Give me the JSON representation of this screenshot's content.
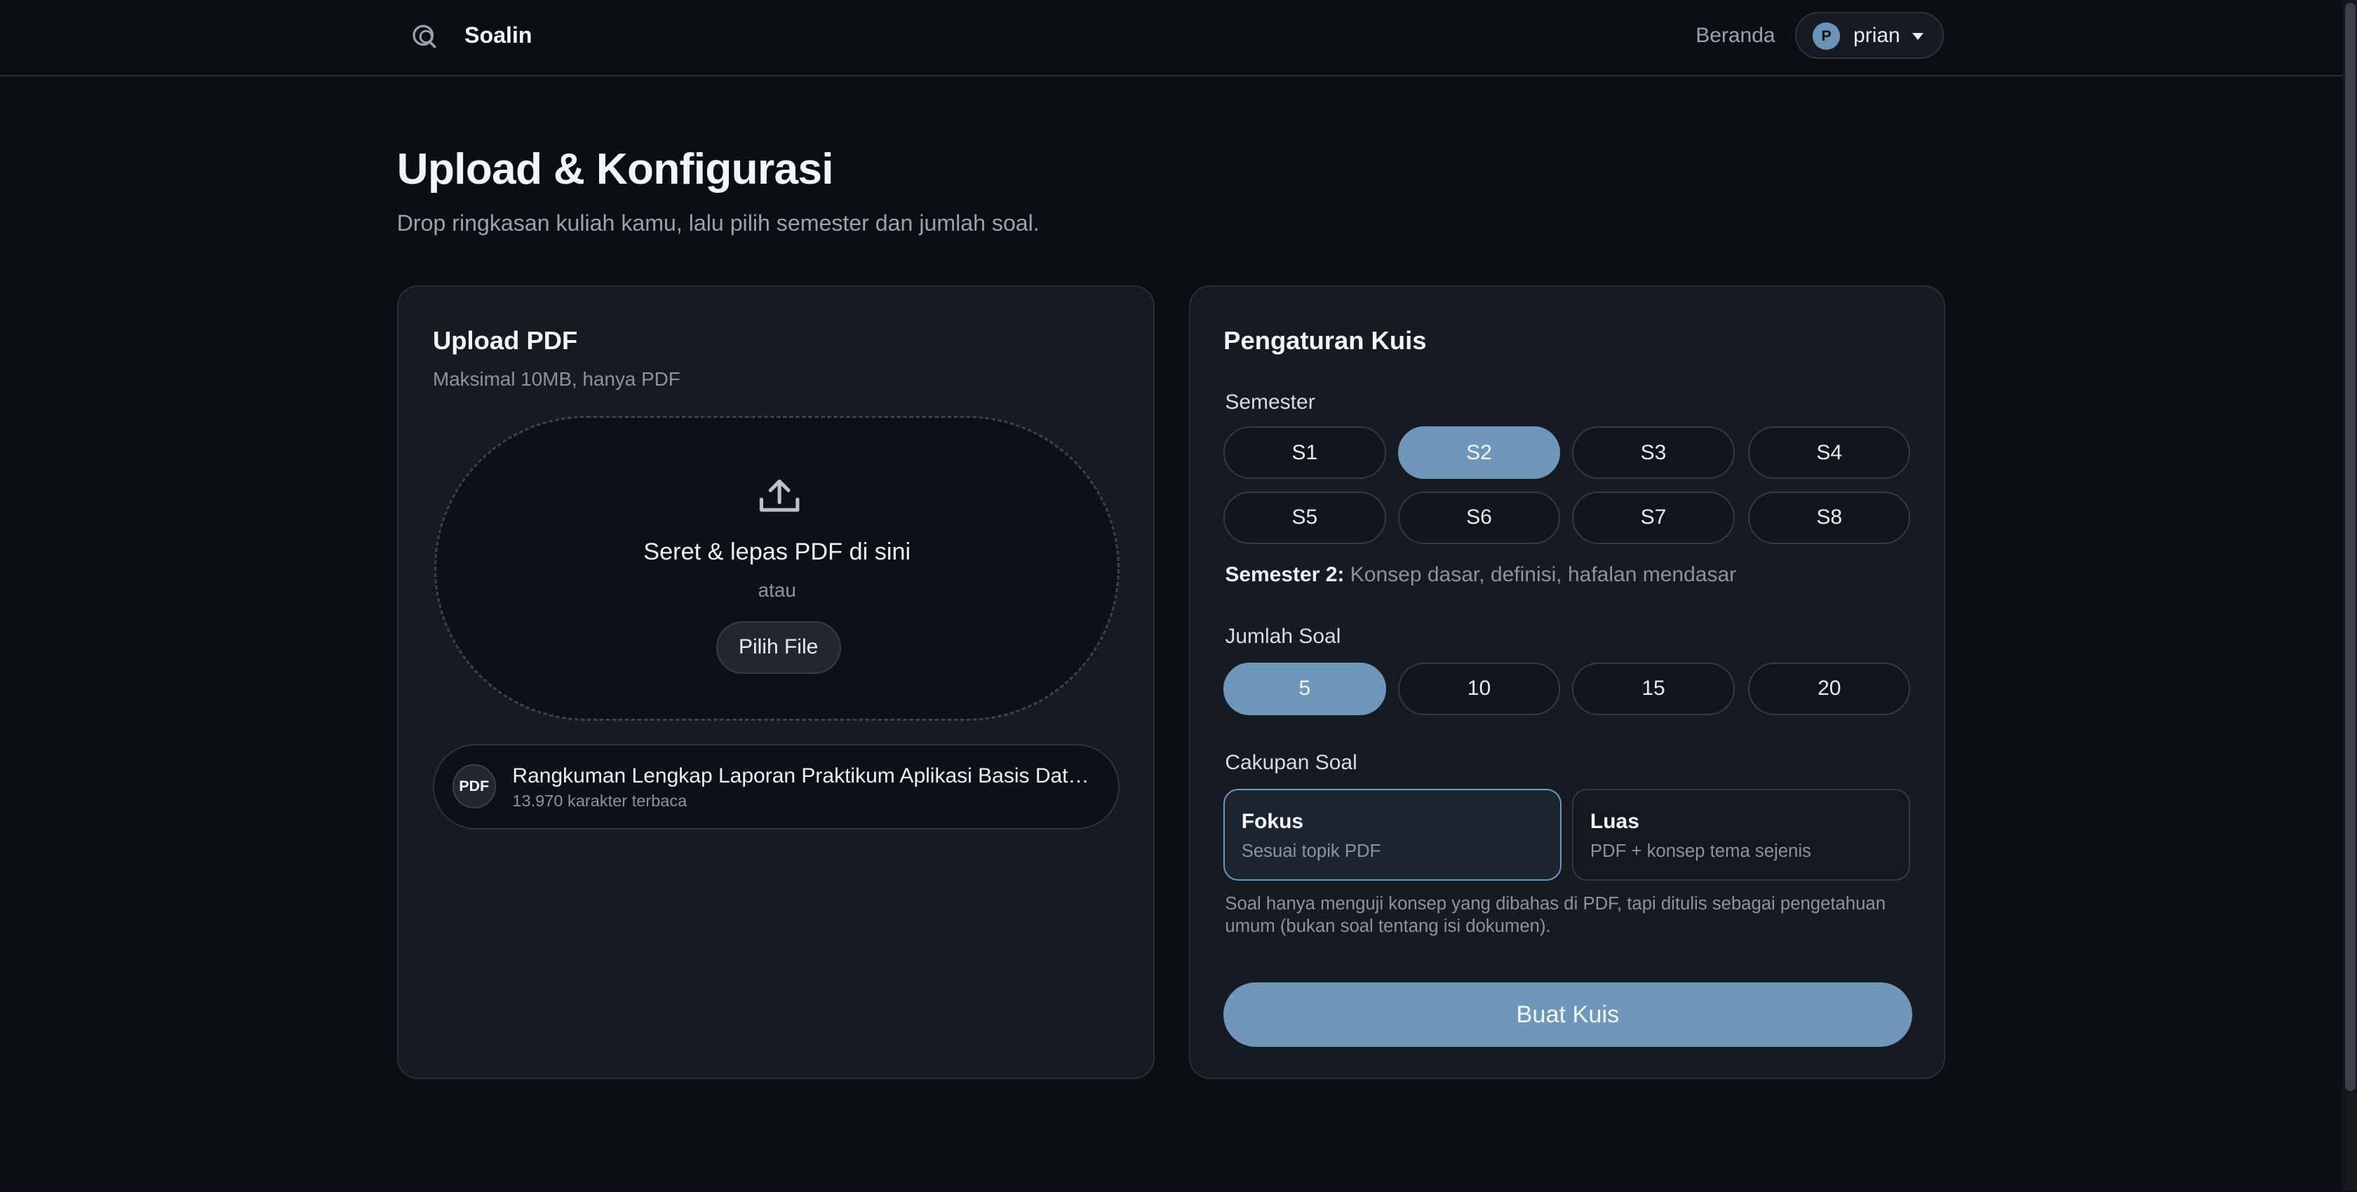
{
  "header": {
    "brand_name": "Soalin",
    "nav_home": "Beranda",
    "user": {
      "initial": "P",
      "name": "prian"
    }
  },
  "page": {
    "title": "Upload & Konfigurasi",
    "subtitle": "Drop ringkasan kuliah kamu, lalu pilih semester dan jumlah soal."
  },
  "upload": {
    "title": "Upload PDF",
    "subtitle": "Maksimal 10MB, hanya PDF",
    "dropzone": {
      "text": "Seret & lepas PDF di sini",
      "or": "atau",
      "button": "Pilih File"
    },
    "file": {
      "badge": "PDF",
      "name": "Rangkuman Lengkap Laporan Praktikum Aplikasi Basis Data.pdf",
      "meta": "13.970 karakter terbaca"
    }
  },
  "settings": {
    "title": "Pengaturan Kuis",
    "semester": {
      "label": "Semester",
      "options": [
        "S1",
        "S2",
        "S3",
        "S4",
        "S5",
        "S6",
        "S7",
        "S8"
      ],
      "selected": "S2",
      "desc_label": "Semester 2:",
      "desc_text": "Konsep dasar, definisi, hafalan mendasar"
    },
    "count": {
      "label": "Jumlah Soal",
      "options": [
        "5",
        "10",
        "15",
        "20"
      ],
      "selected": "5"
    },
    "scope": {
      "label": "Cakupan Soal",
      "options": [
        {
          "title": "Fokus",
          "sub": "Sesuai topik PDF"
        },
        {
          "title": "Luas",
          "sub": "PDF + konsep tema sejenis"
        }
      ],
      "selected": "Fokus",
      "note": "Soal hanya menguji konsep yang dibahas di PDF, tapi ditulis sebagai pengetahuan umum (bukan soal tentang isi dokumen)."
    },
    "submit": "Buat Kuis"
  },
  "colors": {
    "accent": "#6f97bb",
    "background": "#0b0e13",
    "card": "#161a21"
  }
}
